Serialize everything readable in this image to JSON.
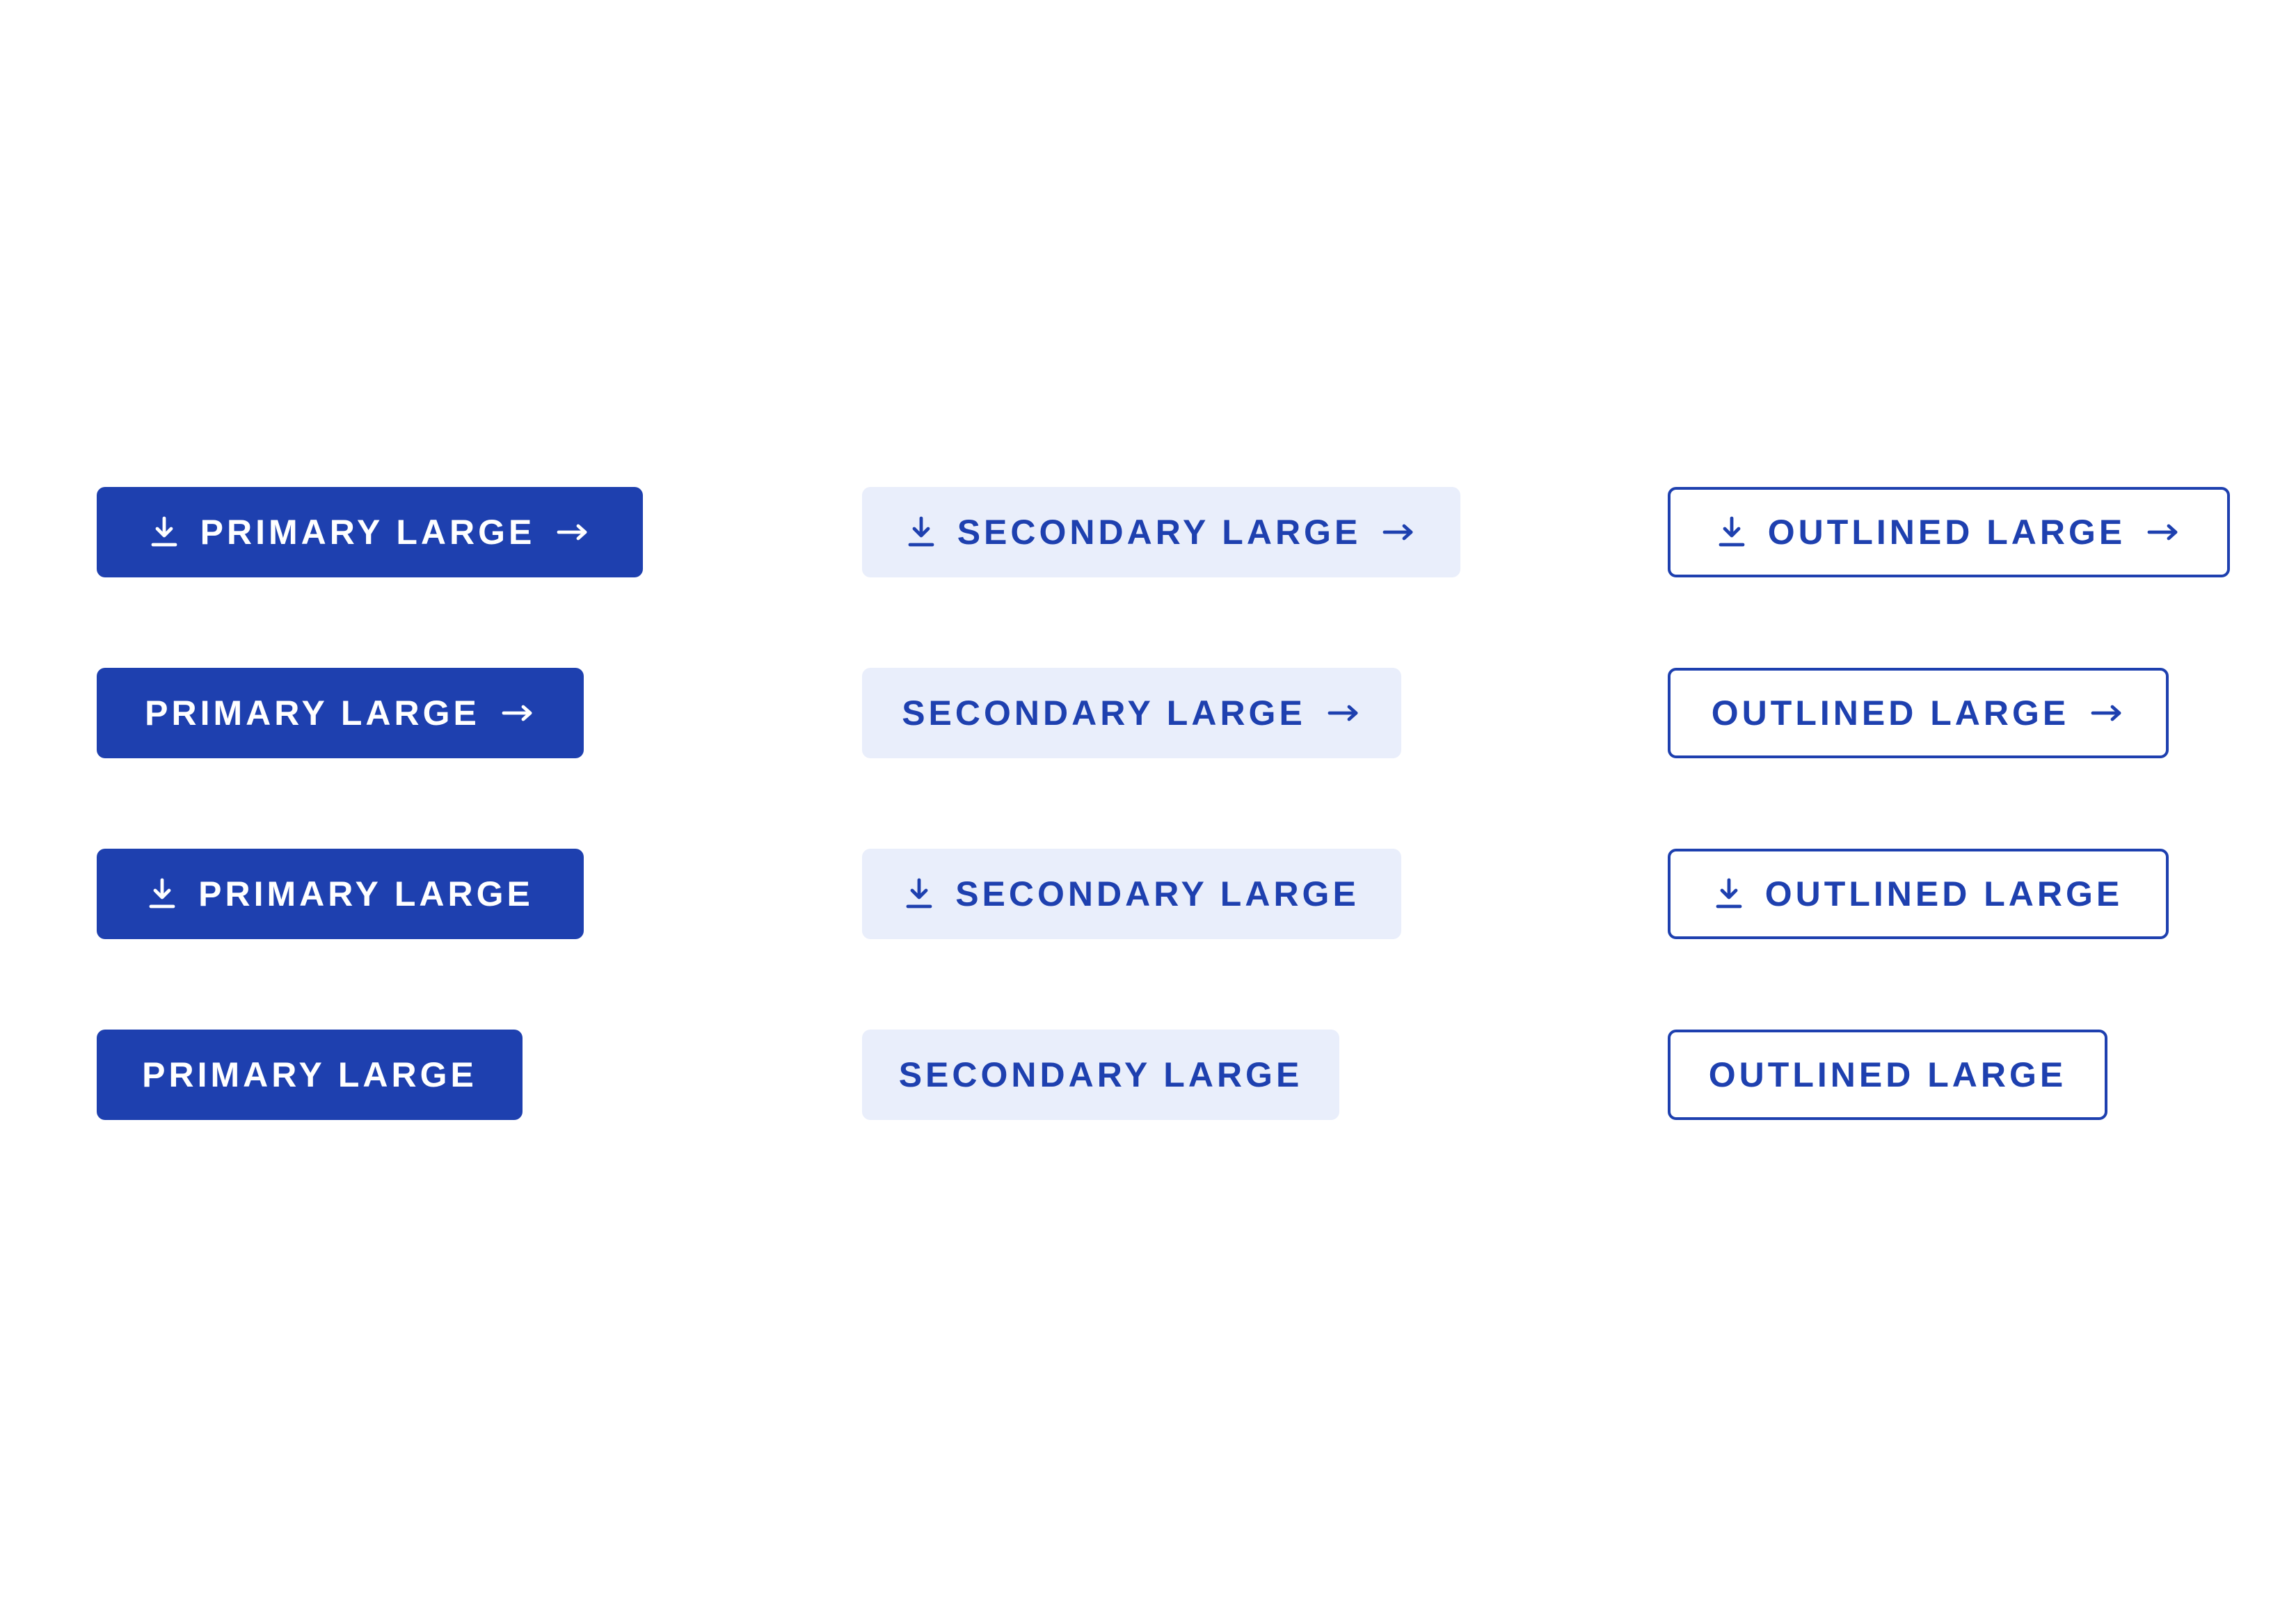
{
  "colors": {
    "primary": "#1e40af",
    "secondary_bg": "#e9eefb",
    "background": "#ffffff"
  },
  "icons": {
    "leading": "download-icon",
    "trailing": "arrow-right-icon"
  },
  "primary": {
    "both_icons_label": "PRIMARY LARGE",
    "trailing_icon_label": "PRIMARY LARGE",
    "leading_icon_label": "PRIMARY LARGE",
    "no_icon_label": "PRIMARY LARGE"
  },
  "secondary": {
    "both_icons_label": "SECONDARY LARGE",
    "trailing_icon_label": "SECONDARY LARGE",
    "leading_icon_label": "SECONDARY LARGE",
    "no_icon_label": "SECONDARY LARGE"
  },
  "outlined": {
    "both_icons_label": "OUTLINED LARGE",
    "trailing_icon_label": "OUTLINED LARGE",
    "leading_icon_label": "OUTLINED LARGE",
    "no_icon_label": "OUTLINED LARGE"
  }
}
